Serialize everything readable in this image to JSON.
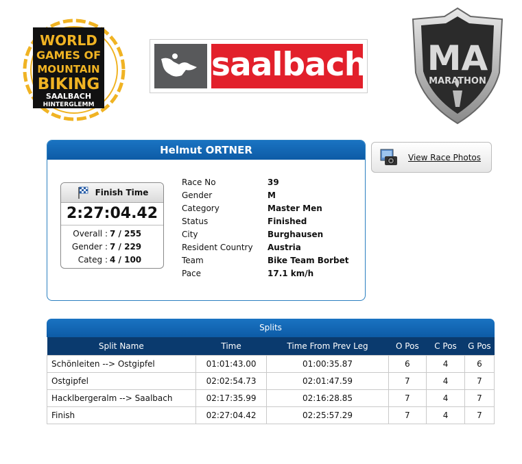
{
  "logos": {
    "wgmb_lines": [
      "WORLD",
      "GAMES OF",
      "MOUNTAIN",
      "BIKING",
      "SAALBACH",
      "HINTERGLEMM"
    ],
    "saalbach_word": "saalbach",
    "ma_letters": "MA",
    "ma_word": "MARATHON"
  },
  "athlete": {
    "name": "Helmut ORTNER",
    "finish_label": "Finish Time",
    "finish_time": "2:27:04.42",
    "ranks": [
      {
        "label": "Overall :",
        "value": "7 / 255"
      },
      {
        "label": "Gender :",
        "value": "7 / 229"
      },
      {
        "label": "Categ :",
        "value": "4 / 100"
      }
    ],
    "info": [
      {
        "key": "Race No",
        "value": "39"
      },
      {
        "key": "Gender",
        "value": "M"
      },
      {
        "key": "Category",
        "value": "Master Men"
      },
      {
        "key": "Status",
        "value": "Finished"
      },
      {
        "key": "City",
        "value": "Burghausen"
      },
      {
        "key": "Resident Country",
        "value": "Austria"
      },
      {
        "key": "Team",
        "value": "Bike Team Borbet"
      },
      {
        "key": "Pace",
        "value": "17.1 km/h"
      }
    ]
  },
  "photos_button": {
    "label": "View Race Photos",
    "icon": "camera-icon"
  },
  "splits": {
    "title": "Splits",
    "columns": [
      "Split Name",
      "Time",
      "Time From Prev Leg",
      "O Pos",
      "C Pos",
      "G Pos"
    ],
    "rows": [
      [
        "Schönleiten --> Ostgipfel",
        "01:01:43.00",
        "01:00:35.87",
        "6",
        "4",
        "6"
      ],
      [
        "Ostgipfel",
        "02:02:54.73",
        "02:01:47.59",
        "7",
        "4",
        "7"
      ],
      [
        "Hacklbergeralm --> Saalbach",
        "02:17:35.99",
        "02:16:28.85",
        "7",
        "4",
        "7"
      ],
      [
        "Finish",
        "02:27:04.42",
        "02:25:57.29",
        "7",
        "4",
        "7"
      ]
    ]
  },
  "colors": {
    "header_blue": "#1a73c2",
    "table_head": "#0a3a6e",
    "saalbach_red": "#e2202b",
    "wgmb_yellow": "#f0b323"
  }
}
